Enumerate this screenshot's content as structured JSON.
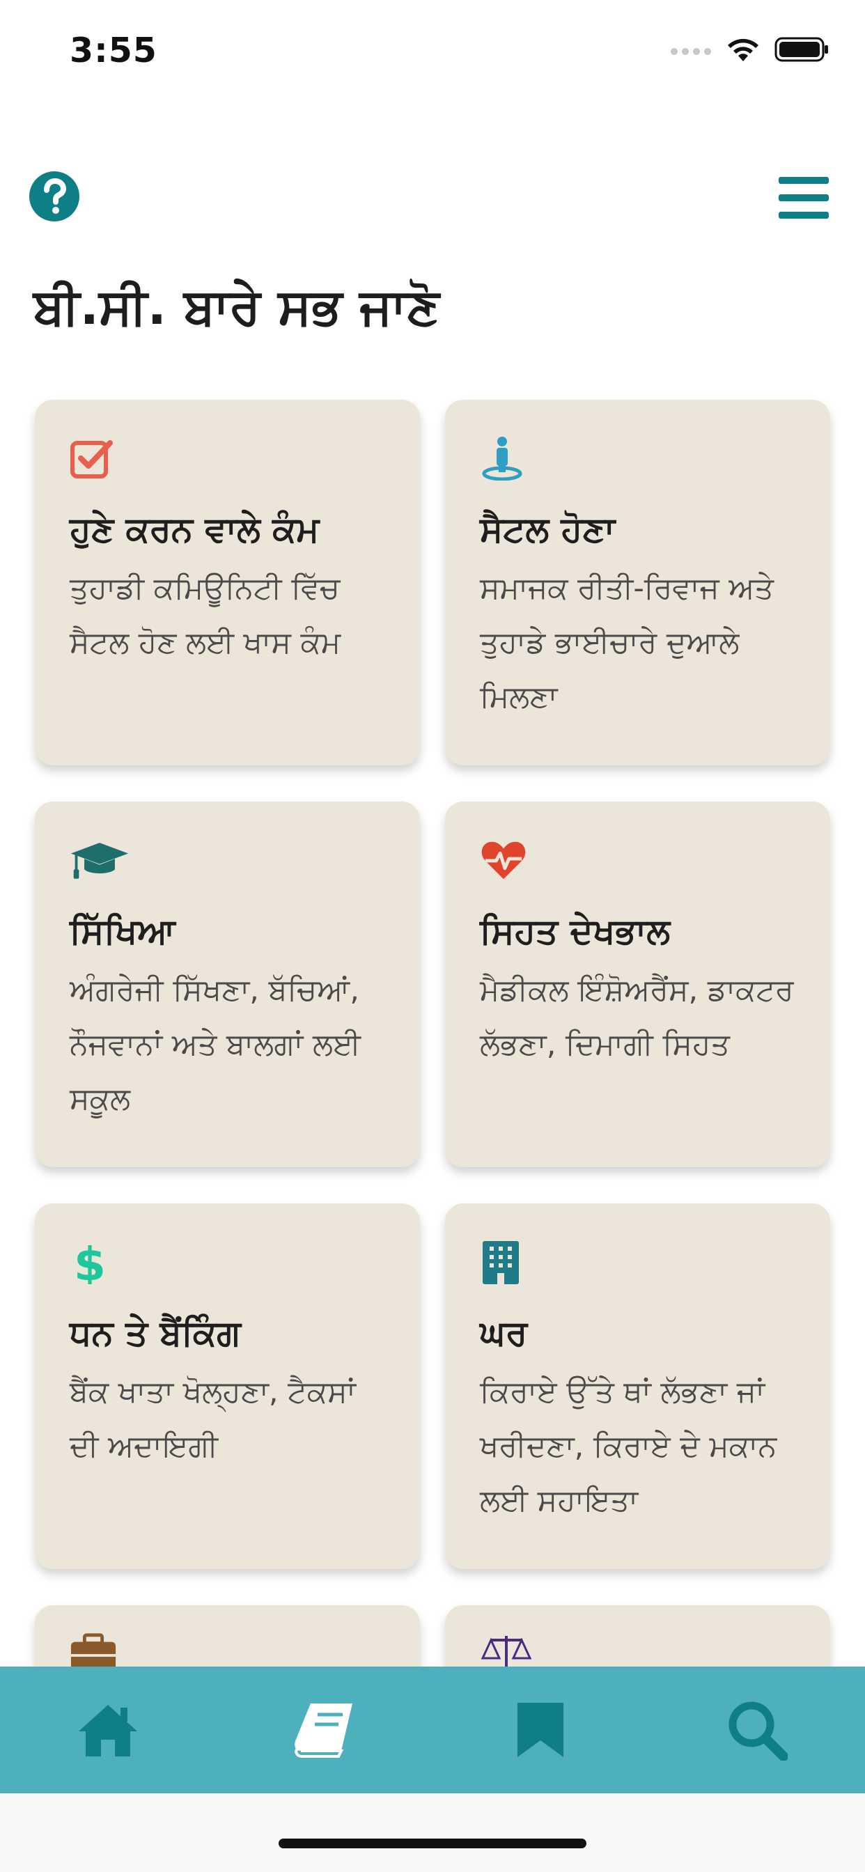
{
  "status": {
    "time": "3:55"
  },
  "header": {
    "help_icon": "question-circle-icon",
    "menu_icon": "hamburger-menu-icon"
  },
  "page": {
    "title": "ਬੀ.ਸੀ. ਬਾਰੇ ਸਭ ਜਾਣੋ"
  },
  "cards": [
    {
      "icon": "checkbox-icon",
      "icon_color": "#e8604c",
      "title": "ਹੁਣੇ ਕਰਨ ਵਾਲੇ ਕੰਮ",
      "desc": "ਤੁਹਾਡੀ ਕਮਿਊਨਿਟੀ ਵਿੱਚ ਸੈਟਲ ਹੋਣ ਲਈ ਖਾਸ ਕੰਮ"
    },
    {
      "icon": "person-pin-icon",
      "icon_color": "#2e9ec2",
      "title": "ਸੈਟਲ ਹੋਣਾ",
      "desc": "ਸਮਾਜਕ ਰੀਤੀ-ਰਿਵਾਜ ਅਤੇ ਤੁਹਾਡੇ ਭਾਈਚਾਰੇ ਦੁਆਲੇ ਮਿਲਣਾ"
    },
    {
      "icon": "graduation-cap-icon",
      "icon_color": "#1e6f6b",
      "title": "ਸਿੱਖਿਆ",
      "desc": "ਅੰਗਰੇਜੀ ਸਿੱਖਣਾ, ਬੱਚਿਆਂ, ਨੌਜਵਾਨਾਂ ਅਤੇ ਬਾਲਗਾਂ ਲਈ ਸਕੂਲ"
    },
    {
      "icon": "heartbeat-icon",
      "icon_color": "#e0452b",
      "title": "ਸਿਹਤ ਦੇਖਭਾਲ",
      "desc": "ਮੈਡੀਕਲ ਇੰਸ਼ੋਅਰੈਂਸ, ਡਾਕਟਰ ਲੱਭਣਾ, ਦਿਮਾਗੀ ਸਿਹਤ"
    },
    {
      "icon": "dollar-icon",
      "icon_color": "#1fc79c",
      "title": "ਧਨ ਤੇ ਬੈਂਕਿੰਗ",
      "desc": "ਬੈਂਕ ਖਾਤਾ ਖੋਲ੍ਹਣਾ, ਟੈਕਸਾਂ ਦੀ ਅਦਾਇਗੀ"
    },
    {
      "icon": "building-icon",
      "icon_color": "#1e7b87",
      "title": "ਘਰ",
      "desc": "ਕਿਰਾਏ ਉੱਤੇ ਥਾਂ ਲੱਭਣਾ ਜਾਂ ਖਰੀਦਣਾ, ਕਿਰਾਏ ਦੇ ਮਕਾਨ ਲਈ ਸਹਾਇਤਾ"
    }
  ],
  "partial_cards": [
    {
      "icon": "briefcase-icon",
      "icon_color": "#8a5a2b"
    },
    {
      "icon": "scales-icon",
      "icon_color": "#4b2a86"
    }
  ],
  "tabbar": {
    "tabs": [
      {
        "icon": "home-icon",
        "active": false
      },
      {
        "icon": "book-icon",
        "active": true
      },
      {
        "icon": "bookmark-icon",
        "active": false
      },
      {
        "icon": "search-icon",
        "active": false
      }
    ],
    "icon_color": "#0e7f86",
    "active_color": "#ffffff"
  }
}
